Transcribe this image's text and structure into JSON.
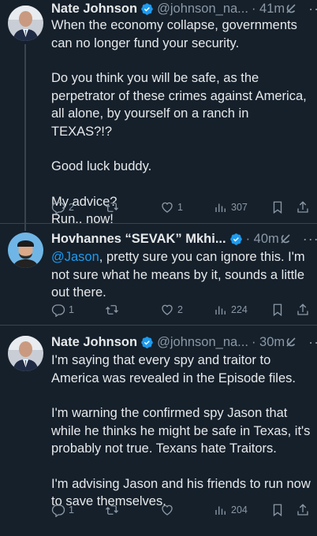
{
  "tweets": [
    {
      "name": "Nate Johnson",
      "handle": "@johnson_na...",
      "time": "· 41m",
      "avatar": "avatar-bald-man-suit",
      "body": [
        "When the economy collapse, governments can no longer fund your security.",
        "Do you think you will be safe, as the perpetrator of these crimes against America, all alone, by yourself on a ranch in TEXAS?!?",
        "Good luck buddy.",
        "My advice?\nRun.. now!"
      ],
      "replies": "2",
      "reposts": "",
      "likes": "1",
      "views": "307"
    },
    {
      "name": "Hovhannes “SEVAK” Mkhi...",
      "handle": "",
      "time": "· 40m",
      "avatar": "avatar-bearded-man-cap",
      "mention": "@Jason",
      "body_after_mention": ", pretty sure you can ignore this. I'm not sure what he means by it, sounds a little out there.",
      "replies": "1",
      "reposts": "",
      "likes": "2",
      "views": "224"
    },
    {
      "name": "Nate Johnson",
      "handle": "@johnson_na...",
      "time": "· 30m",
      "avatar": "avatar-bald-man-suit",
      "body": [
        "I'm saying that every spy and traitor to America was revealed in the Episode files.",
        "I'm warning the confirmed spy Jason that while he thinks he might be safe in Texas, it's probably not true.  Texans hate Traitors.",
        "I'm advising Jason and his friends to run now to save themselves."
      ],
      "replies": "1",
      "reposts": "",
      "likes": "",
      "views": "204"
    }
  ],
  "icons": {
    "verified": "verified-badge-icon",
    "grok": "grok-icon",
    "more": "more-icon",
    "reply": "reply-icon",
    "repost": "repost-icon",
    "like": "like-icon",
    "views": "views-icon",
    "bookmark": "bookmark-icon",
    "share": "share-icon"
  },
  "colors": {
    "background": "#15202b",
    "text": "#e7e9ea",
    "secondary": "#8b98a5",
    "accent": "#1d9bf0",
    "divider": "#38444d"
  }
}
